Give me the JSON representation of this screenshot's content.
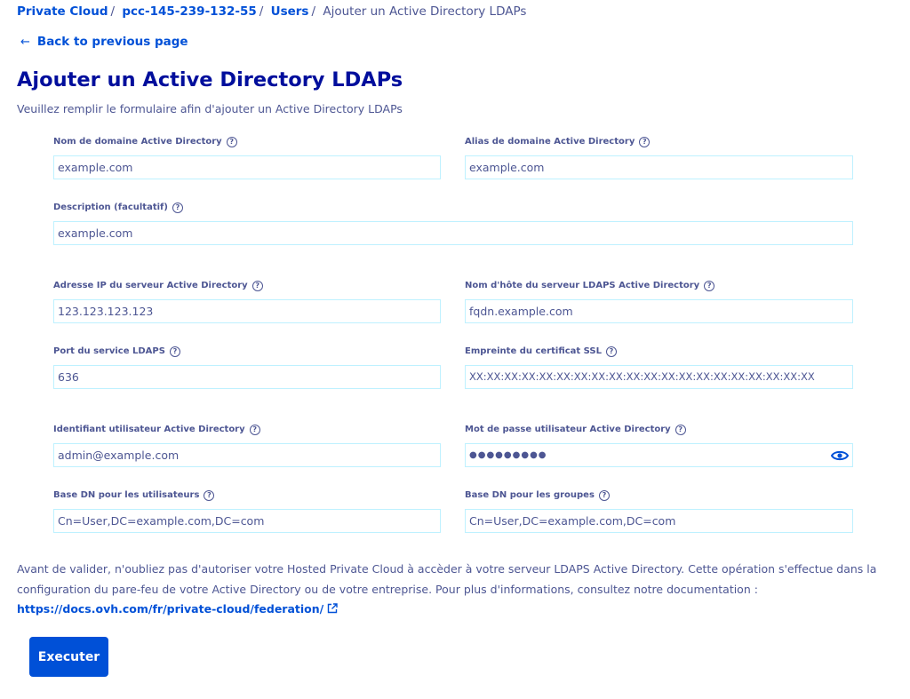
{
  "breadcrumb": {
    "items": [
      "Private Cloud",
      "pcc-145-239-132-55",
      "Users"
    ],
    "current": "Ajouter un Active Directory LDAPs"
  },
  "back_link": "Back to previous page",
  "page": {
    "title": "Ajouter un Active Directory LDAPs",
    "subtitle": "Veuillez remplir le formulaire afin d'ajouter un Active Directory LDAPs"
  },
  "form": {
    "domain_name": {
      "label": "Nom de domaine Active Directory",
      "placeholder": "example.com"
    },
    "domain_alias": {
      "label": "Alias de domaine Active Directory",
      "placeholder": "example.com"
    },
    "description": {
      "label": "Description (facultatif)",
      "placeholder": "example.com"
    },
    "server_ip": {
      "label": "Adresse IP du serveur Active Directory",
      "placeholder": "123.123.123.123"
    },
    "ldaps_hostname": {
      "label": "Nom d'hôte du serveur LDAPS Active Directory",
      "placeholder": "fqdn.example.com"
    },
    "ldaps_port": {
      "label": "Port du service LDAPS",
      "placeholder": "636"
    },
    "ssl_fingerprint": {
      "label": "Empreinte du certificat SSL",
      "placeholder": "XX:XX:XX:XX:XX:XX:XX:XX:XX:XX:XX:XX:XX:XX:XX:XX:XX:XX:XX:XX"
    },
    "username": {
      "label": "Identifiant utilisateur Active Directory",
      "placeholder": "admin@example.com"
    },
    "password": {
      "label": "Mot de passe utilisateur Active Directory",
      "value": "●●●●●●●●●"
    },
    "base_dn_users": {
      "label": "Base DN pour les utilisateurs",
      "placeholder": "Cn=User,DC=example.com,DC=com"
    },
    "base_dn_groups": {
      "label": "Base DN pour les groupes",
      "placeholder": "Cn=User,DC=example.com,DC=com"
    }
  },
  "note": {
    "text": "Avant de valider, n'oubliez pas d'autoriser votre Hosted Private Cloud à accèder à votre serveur LDAPS Active Directory. Cette opération s'effectue dans la configuration du pare-feu de votre Active Directory ou de votre entreprise. Pour plus d'informations, consultez notre documentation : ",
    "link": "https://docs.ovh.com/fr/private-cloud/federation/"
  },
  "submit_label": "Executer",
  "icons": {
    "help": "question-circle-icon",
    "eye": "eye-icon",
    "back": "arrow-left-icon",
    "external": "external-link-icon"
  },
  "colors": {
    "primary": "#0050d7",
    "title": "#000e9c",
    "text": "#4d5693",
    "input_border": "#bef1ff"
  }
}
